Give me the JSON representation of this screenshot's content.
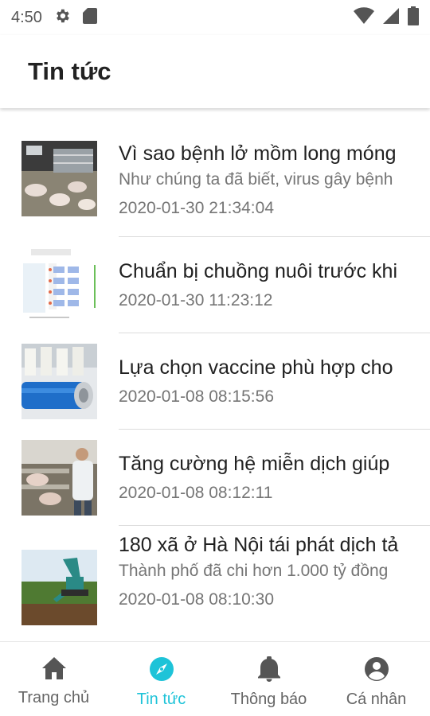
{
  "status_bar": {
    "time": "4:50",
    "left_icons": [
      "settings-icon",
      "sd-card-icon"
    ],
    "right_icons": [
      "wifi-icon",
      "cellular-signal-icon",
      "battery-icon"
    ]
  },
  "app_bar": {
    "title": "Tin tức"
  },
  "news": [
    {
      "title": "Vì sao bệnh lở mồm long móng",
      "summary": "Như chúng ta đã biết, virus gây bệnh",
      "date": "2020-01-30 21:34:04",
      "thumb": "pig-barn-photo"
    },
    {
      "title": "Chuẩn bị chuồng nuôi trước khi",
      "summary": "",
      "date": "2020-01-30 11:23:12",
      "thumb": "barn-layout-diagram"
    },
    {
      "title": "Lựa chọn vaccine phù hợp cho",
      "summary": "",
      "date": "2020-01-08 08:15:56",
      "thumb": "vaccine-vials-photo"
    },
    {
      "title": "Tăng cường hệ miễn dịch giúp",
      "summary": "",
      "date": "2020-01-08 08:12:11",
      "thumb": "vet-with-pigs-photo"
    },
    {
      "title": "180 xã ở Hà Nội tái phát dịch tả",
      "summary": "Thành phố đã chi hơn 1.000 tỷ đồng",
      "date": "2020-01-08 08:10:30",
      "thumb": "excavator-field-photo"
    }
  ],
  "bottom_nav": [
    {
      "label": "Trang chủ",
      "icon": "home-icon",
      "active": false
    },
    {
      "label": "Tin tức",
      "icon": "compass-icon",
      "active": true
    },
    {
      "label": "Thông báo",
      "icon": "bell-icon",
      "active": false
    },
    {
      "label": "Cá nhân",
      "icon": "account-circle-icon",
      "active": false
    }
  ],
  "colors": {
    "accent": "#1ec3d8",
    "inactive": "#666666",
    "text_secondary": "#757575"
  }
}
